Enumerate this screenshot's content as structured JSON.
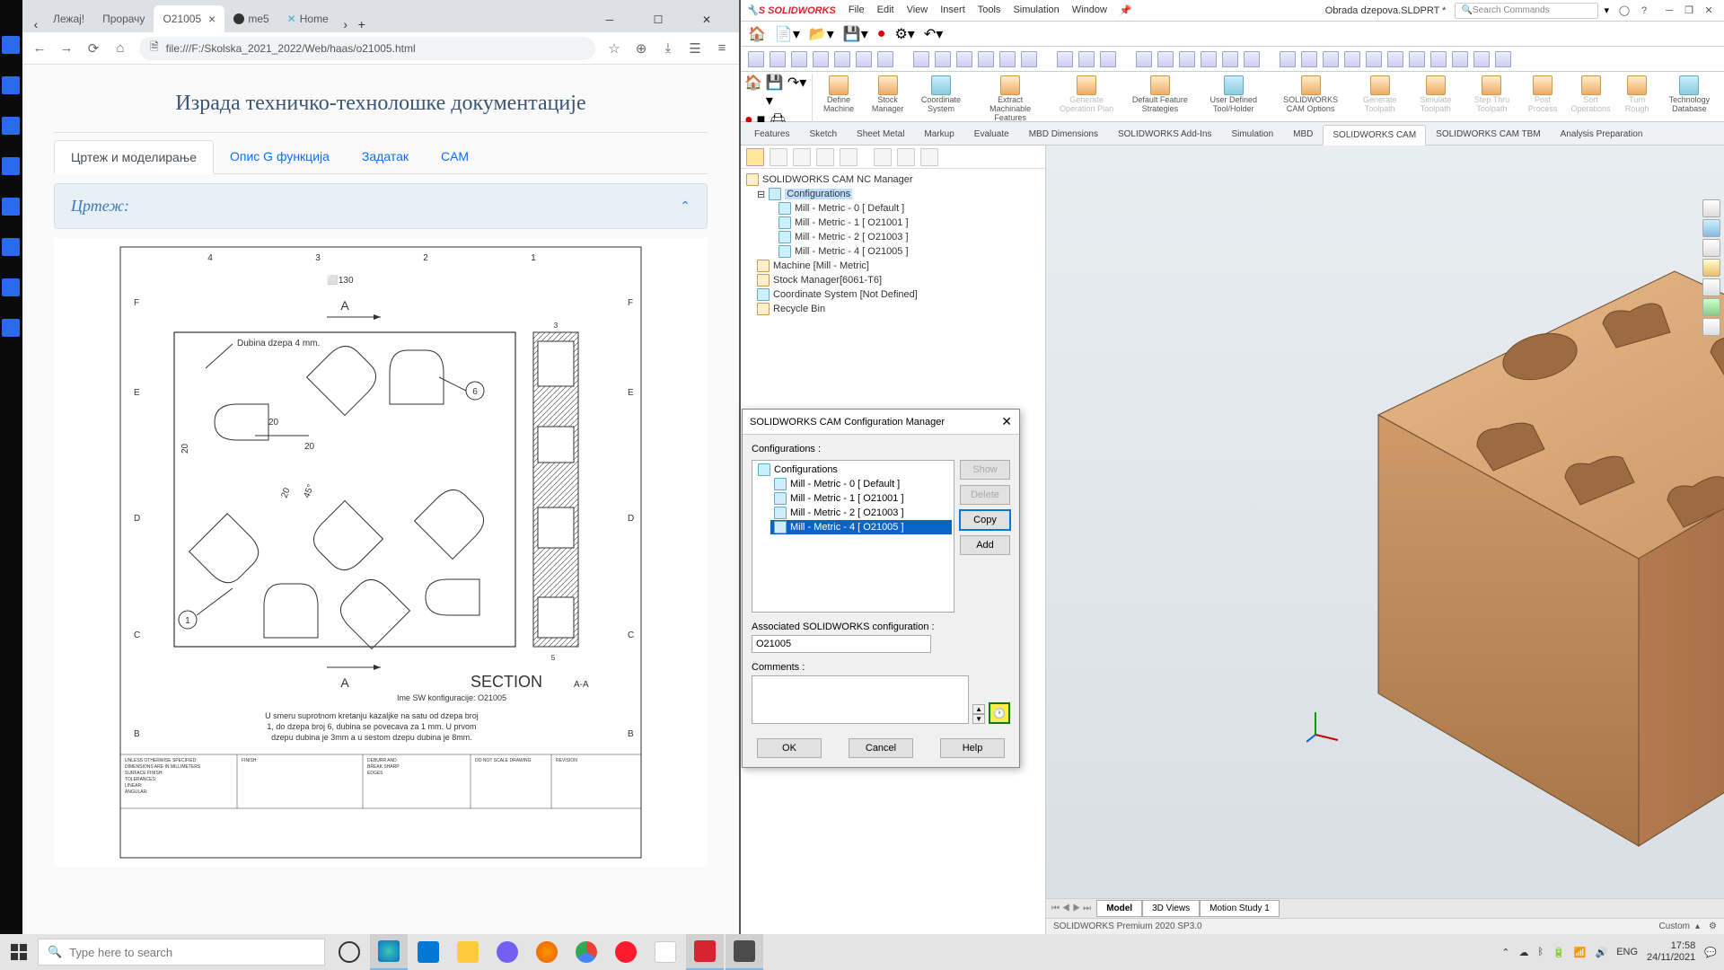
{
  "browser": {
    "tabs": [
      "Лежај!",
      "Прорачу",
      "O21005",
      "me5",
      "Home"
    ],
    "active_tab_index": 2,
    "url": "file:///F:/Skolska_2021_2022/Web/haas/o21005.html",
    "page_title": "Израда техничко-технолошке документације",
    "nav_tabs": [
      "Цртеж и моделирање",
      "Опис G функција",
      "Задатак",
      "CAM"
    ],
    "nav_active_index": 0,
    "accordion_title": "Цртеж:"
  },
  "drawing": {
    "note": "Dubina dzepa 4 mm.",
    "dim130": "130",
    "dim20": "20",
    "balloon1": "1",
    "balloon6": "6",
    "section_label": "SECTION",
    "section_sub": "A-A",
    "config_label": "Ime SW konfiguracije: O21005",
    "desc1": "U smeru suprotnom kretanju kazaljke na satu od dzepa broj",
    "desc2": "1, do dzepa broj 6, dubina se povecava za 1 mm. U prvom",
    "desc3": "dzepu dubina je 3mm a u sestom dzepu dubina je 8mm.",
    "col_labels_top": [
      "4",
      "3",
      "2",
      "1"
    ],
    "row_labels": [
      "F",
      "E",
      "D",
      "C"
    ],
    "tb_unless": "UNLESS OTHERWISE SPECIFIED:",
    "tb_dims": "DIMENSIONS ARE IN MILLIMETERS",
    "tb_finish": "FINISH:",
    "tb_deburr": "DEBURR AND BREAK SHARP EDGES",
    "tb_scale": "DO NOT SCALE DRAWING",
    "tb_rev": "REVISION"
  },
  "sw": {
    "menus": [
      "File",
      "Edit",
      "View",
      "Insert",
      "Tools",
      "Simulation",
      "Window"
    ],
    "doc_name": "Obrada dzepova.SLDPRT *",
    "search_placeholder": "Search Commands",
    "ribbon": [
      "Define Machine",
      "Stock Manager",
      "Coordinate System",
      "Extract Machinable Features",
      "Generate Operation Plan",
      "Default Feature Strategies",
      "User Defined Tool/Holder",
      "SOLIDWORKS CAM Options",
      "Generate Toolpath",
      "Simulate Toolpath",
      "Step Thru Toolpath",
      "Post Process",
      "Sort Operations",
      "Turn Rough",
      "Technology Database"
    ],
    "ribbon_disabled": [
      4,
      8,
      9,
      10,
      11,
      12,
      13
    ],
    "cmd_tabs": [
      "Features",
      "Sketch",
      "Sheet Metal",
      "Markup",
      "Evaluate",
      "MBD Dimensions",
      "SOLIDWORKS Add-Ins",
      "Simulation",
      "MBD",
      "SOLIDWORKS CAM",
      "SOLIDWORKS CAM TBM",
      "Analysis Preparation"
    ],
    "cmd_active_index": 9,
    "tree": {
      "root": "SOLIDWORKS CAM NC Manager",
      "configs": "Configurations",
      "items": [
        "Mill - Metric - 0 [ Default ]",
        "Mill - Metric - 1 [ O21001 ]",
        "Mill - Metric - 2 [ O21003 ]",
        "Mill - Metric - 4 [ O21005 ]"
      ],
      "machine": "Machine [Mill - Metric]",
      "stock": "Stock Manager[6061-T6]",
      "cs": "Coordinate System [Not Defined]",
      "bin": "Recycle Bin"
    },
    "bottom_tabs": [
      "Model",
      "3D Views",
      "Motion Study 1"
    ],
    "status": "SOLIDWORKS Premium 2020 SP3.0",
    "status_right": "Custom"
  },
  "dialog": {
    "title": "SOLIDWORKS CAM Configuration Manager",
    "configs_label": "Configurations :",
    "root": "Configurations",
    "items": [
      "Mill - Metric - 0 [ Default ]",
      "Mill - Metric - 1 [ O21001 ]",
      "Mill - Metric - 2 [ O21003 ]",
      "Mill - Metric - 4 [ O21005 ]"
    ],
    "selected_index": 3,
    "btns": [
      "Show",
      "Delete",
      "Copy",
      "Add"
    ],
    "assoc_label": "Associated SOLIDWORKS configuration :",
    "assoc_value": "O21005",
    "comments_label": "Comments :",
    "ok": "OK",
    "cancel": "Cancel",
    "help": "Help"
  },
  "taskbar": {
    "search": "Type here to search",
    "lang": "ENG",
    "time": "17:58",
    "date": "24/11/2021"
  }
}
